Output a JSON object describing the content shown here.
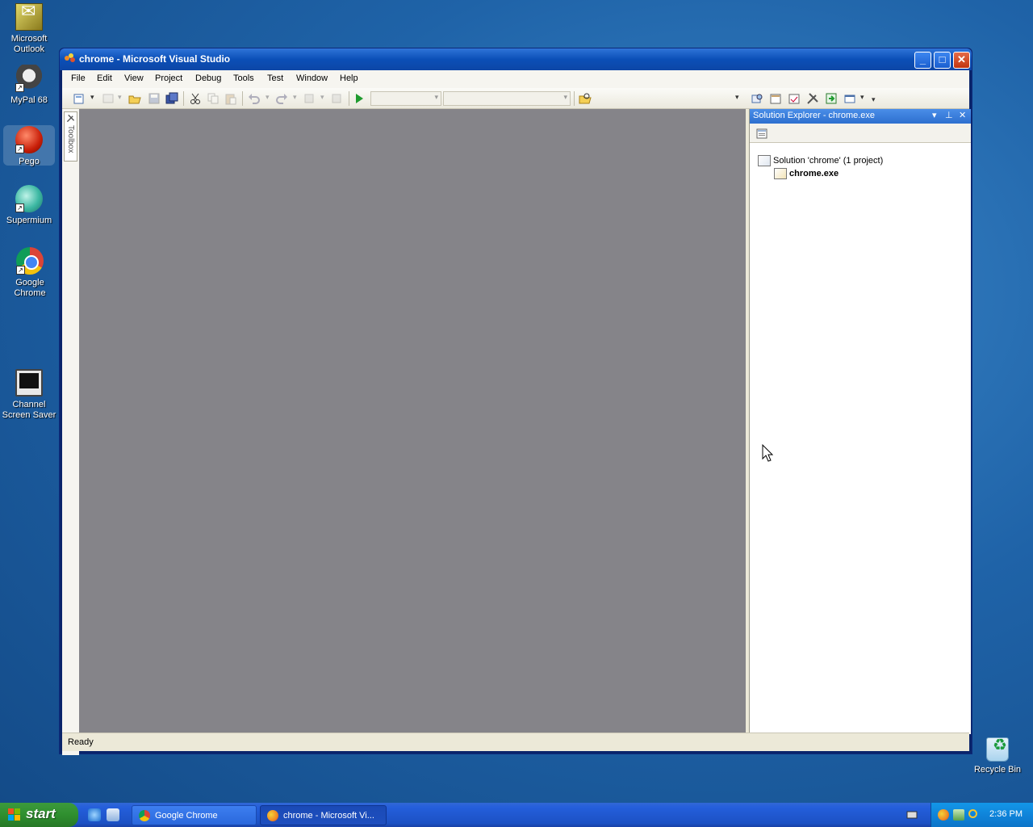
{
  "desktop": {
    "icons": [
      {
        "label": "Microsoft Outlook",
        "icon": "outlook-icon"
      },
      {
        "label": "MyPal 68",
        "icon": "mypal-icon"
      },
      {
        "label": "Pego",
        "icon": "pego-icon"
      },
      {
        "label": "Supermium",
        "icon": "supermium-icon"
      },
      {
        "label": "Google Chrome",
        "icon": "chrome-icon"
      },
      {
        "label": "Channel Screen Saver",
        "icon": "monitor-icon"
      },
      {
        "label": "Recycle Bin",
        "icon": "recycle-bin-icon"
      }
    ]
  },
  "window": {
    "title": "chrome - Microsoft Visual Studio",
    "minimize": "_",
    "maximize": "□",
    "close": "✕"
  },
  "menubar": {
    "items": [
      "File",
      "Edit",
      "View",
      "Project",
      "Debug",
      "Tools",
      "Test",
      "Window",
      "Help"
    ]
  },
  "toolbar": {
    "icons": [
      "add-item-icon",
      "new-project-icon",
      "open-file-icon",
      "save-icon",
      "save-all-icon",
      "cut-icon",
      "copy-icon",
      "paste-icon",
      "undo-icon",
      "redo-icon",
      "navigate-backward-icon",
      "navigate-forward-icon",
      "start-debugging-icon",
      "find-in-files-icon",
      "solution-explorer-icon",
      "properties-icon",
      "object-browser-icon",
      "toolbox-icon",
      "start-page-icon",
      "command-window-icon"
    ]
  },
  "toolbox": {
    "label": "Toolbox"
  },
  "solution_explorer": {
    "title": "Solution Explorer - chrome.exe",
    "solution_label": "Solution 'chrome' (1 project)",
    "project_label": "chrome.exe"
  },
  "statusbar": {
    "text": "Ready"
  },
  "taskbar": {
    "start_label": "start",
    "tasks": [
      {
        "label": "Google Chrome",
        "icon": "chrome-icon"
      },
      {
        "label": "chrome - Microsoft Vi...",
        "icon": "visual-studio-icon"
      }
    ],
    "tray_icons": [
      "keyboard-icon",
      "visual-studio-icon",
      "network-icon",
      "search-icon"
    ],
    "clock": "2:36 PM"
  }
}
